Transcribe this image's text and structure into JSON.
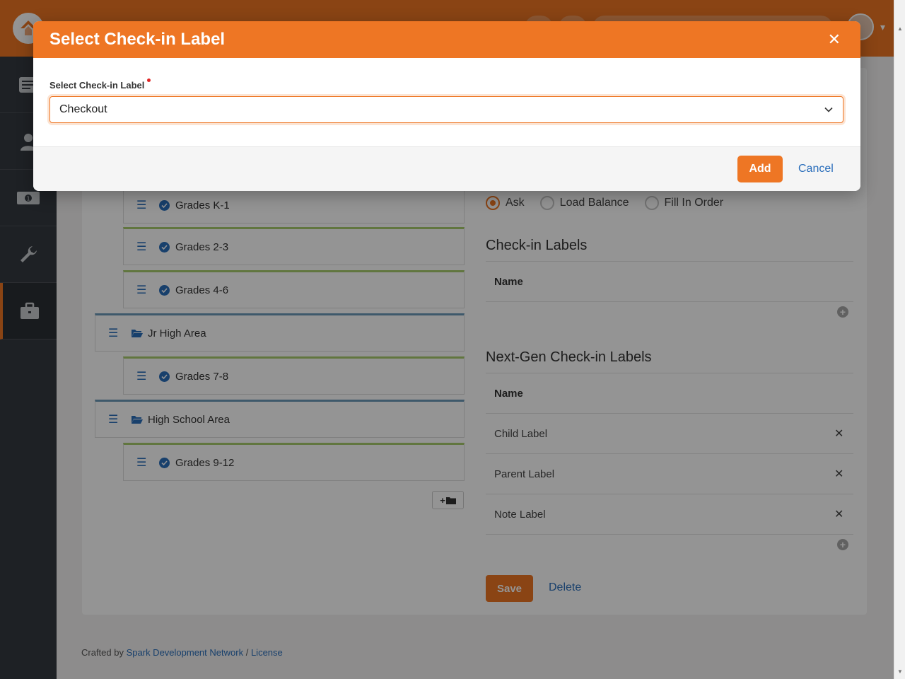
{
  "modal": {
    "title": "Select Check-in Label",
    "field_label": "Select Check-in Label",
    "selected_value": "Checkout",
    "add_label": "Add",
    "cancel_label": "Cancel"
  },
  "tree": {
    "items": [
      {
        "label": "Grades K-1",
        "kind": "group-type"
      },
      {
        "label": "Grades 2-3",
        "kind": "group-type"
      },
      {
        "label": "Grades 4-6",
        "kind": "group-type"
      },
      {
        "label": "Jr High Area",
        "kind": "area"
      },
      {
        "label": "Grades 7-8",
        "kind": "group-type"
      },
      {
        "label": "High School Area",
        "kind": "area"
      },
      {
        "label": "Grades 9-12",
        "kind": "group-type"
      }
    ]
  },
  "attendance_rule": {
    "options": [
      "Ask",
      "Load Balance",
      "Fill In Order"
    ],
    "selected": "Ask"
  },
  "checkin_labels": {
    "title": "Check-in Labels",
    "column_name": "Name"
  },
  "nextgen_labels": {
    "title": "Next-Gen Check-in Labels",
    "column_name": "Name",
    "rows": [
      "Child Label",
      "Parent Label",
      "Note Label"
    ]
  },
  "actions": {
    "save_label": "Save",
    "delete_label": "Delete"
  },
  "footer": {
    "prefix": "Crafted by",
    "link1": "Spark Development Network",
    "separator": "/",
    "link2": "License"
  },
  "colors": {
    "accent": "#ee7624",
    "link": "#2a6ebb",
    "sidebar": "#343a40"
  }
}
